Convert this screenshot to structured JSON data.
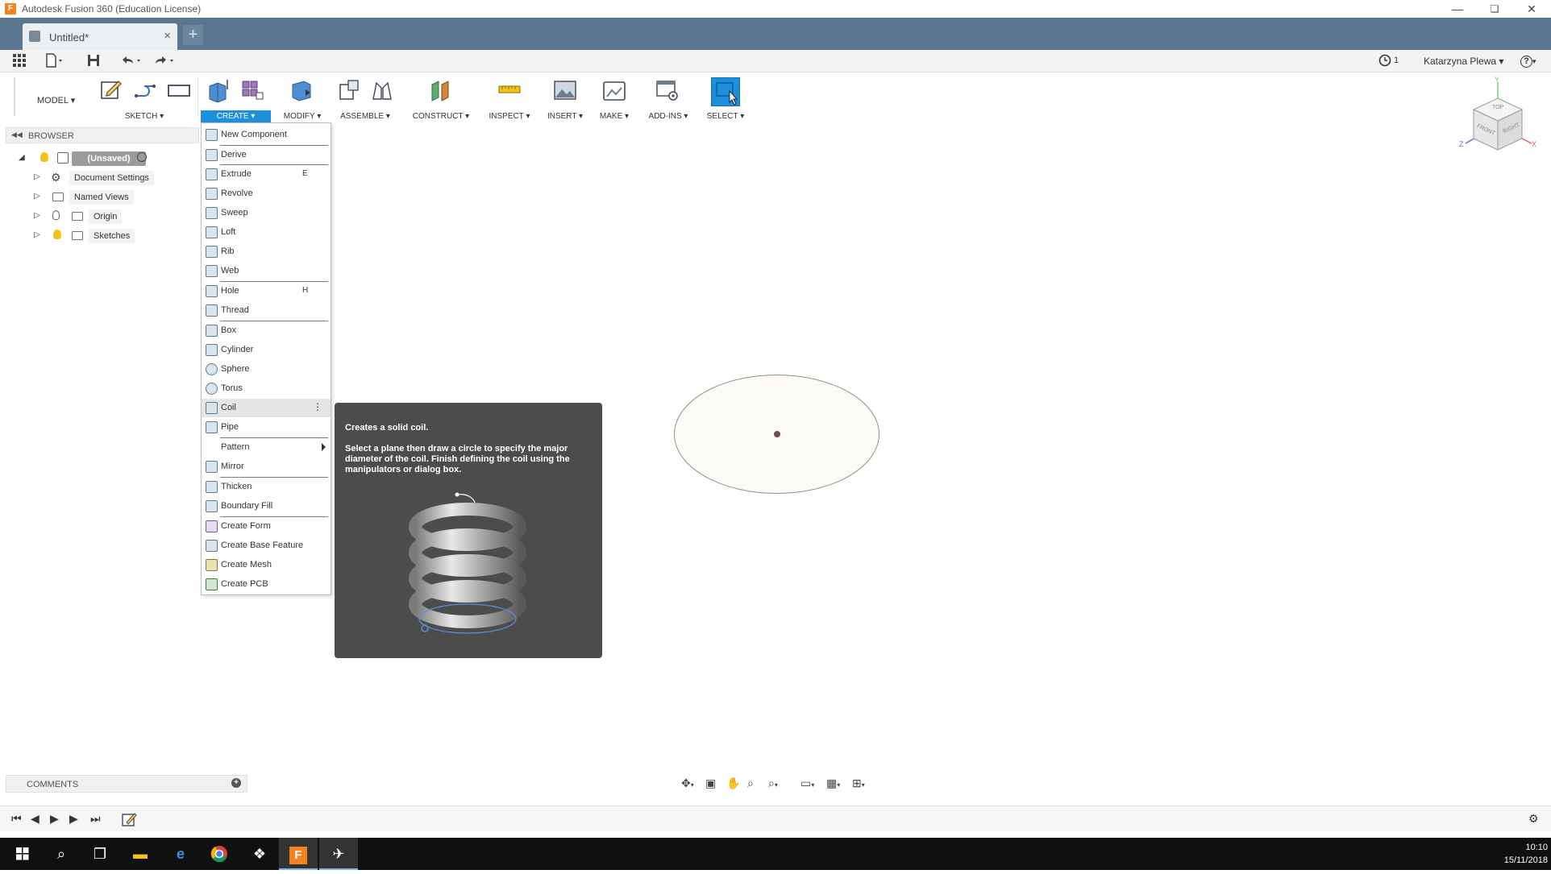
{
  "window": {
    "title": "Autodesk Fusion 360 (Education License)",
    "app_icon_letter": "F",
    "minimize": "—",
    "restore": "❏",
    "close": "✕"
  },
  "tabs": {
    "doc_title": "Untitled*",
    "close": "×",
    "new": "+"
  },
  "quick_access": {
    "job_count": "1",
    "user": "Katarzyna Plewa ▾",
    "help": "?▾"
  },
  "toolbar": {
    "workspace": "MODEL ▾",
    "groups": {
      "sketch": "SKETCH ▾",
      "create": "CREATE ▾",
      "modify": "MODIFY ▾",
      "assemble": "ASSEMBLE ▾",
      "construct": "CONSTRUCT ▾",
      "inspect": "INSPECT ▾",
      "insert": "INSERT ▾",
      "make": "MAKE ▾",
      "addins": "ADD-INS ▾",
      "select": "SELECT ▾"
    }
  },
  "browser": {
    "header": "BROWSER",
    "root": "(Unsaved)",
    "items": [
      {
        "label": "Document Settings"
      },
      {
        "label": "Named Views"
      },
      {
        "label": "Origin"
      },
      {
        "label": "Sketches"
      }
    ]
  },
  "create_menu": {
    "items": [
      {
        "label": "New Component",
        "key": "",
        "icon": "new-component-icon"
      },
      {
        "label": "Derive",
        "key": "",
        "icon": "derive-icon"
      },
      {
        "label": "Extrude",
        "key": "E",
        "icon": "extrude-icon"
      },
      {
        "label": "Revolve",
        "key": "",
        "icon": "revolve-icon"
      },
      {
        "label": "Sweep",
        "key": "",
        "icon": "sweep-icon"
      },
      {
        "label": "Loft",
        "key": "",
        "icon": "loft-icon"
      },
      {
        "label": "Rib",
        "key": "",
        "icon": "rib-icon"
      },
      {
        "label": "Web",
        "key": "",
        "icon": "web-icon"
      },
      {
        "label": "Hole",
        "key": "H",
        "icon": "hole-icon"
      },
      {
        "label": "Thread",
        "key": "",
        "icon": "thread-icon"
      },
      {
        "label": "Box",
        "key": "",
        "icon": "box-icon"
      },
      {
        "label": "Cylinder",
        "key": "",
        "icon": "cylinder-icon"
      },
      {
        "label": "Sphere",
        "key": "",
        "icon": "sphere-icon"
      },
      {
        "label": "Torus",
        "key": "",
        "icon": "torus-icon"
      },
      {
        "label": "Coil",
        "key": "",
        "icon": "coil-icon",
        "highlighted": true
      },
      {
        "label": "Pipe",
        "key": "",
        "icon": "pipe-icon"
      },
      {
        "label": "Pattern",
        "key": "",
        "icon": "",
        "submenu": true
      },
      {
        "label": "Mirror",
        "key": "",
        "icon": "mirror-icon"
      },
      {
        "label": "Thicken",
        "key": "",
        "icon": "thicken-icon"
      },
      {
        "label": "Boundary Fill",
        "key": "",
        "icon": "boundary-fill-icon"
      },
      {
        "label": "Create Form",
        "key": "",
        "icon": "create-form-icon"
      },
      {
        "label": "Create Base Feature",
        "key": "",
        "icon": "create-base-feature-icon"
      },
      {
        "label": "Create Mesh",
        "key": "",
        "icon": "create-mesh-icon"
      },
      {
        "label": "Create PCB",
        "key": "",
        "icon": "create-pcb-icon"
      }
    ]
  },
  "tooltip": {
    "title": "Creates a solid coil.",
    "description": "Select a plane then draw a circle to specify the major diameter of the coil. Finish defining the coil using the manipulators or dialog box."
  },
  "viewcube": {
    "top": "TOP",
    "front": "FRONT",
    "right": "RIGHT",
    "axis_x": "X",
    "axis_y": "Y",
    "axis_z": "Z"
  },
  "comments": {
    "label": "COMMENTS"
  },
  "taskbar": {
    "time": "10:10",
    "date": "15/11/2018"
  },
  "colors": {
    "accent": "#1e8fdd",
    "tab_bar": "#5b7690",
    "tooltip_bg": "#4c4c4c"
  }
}
